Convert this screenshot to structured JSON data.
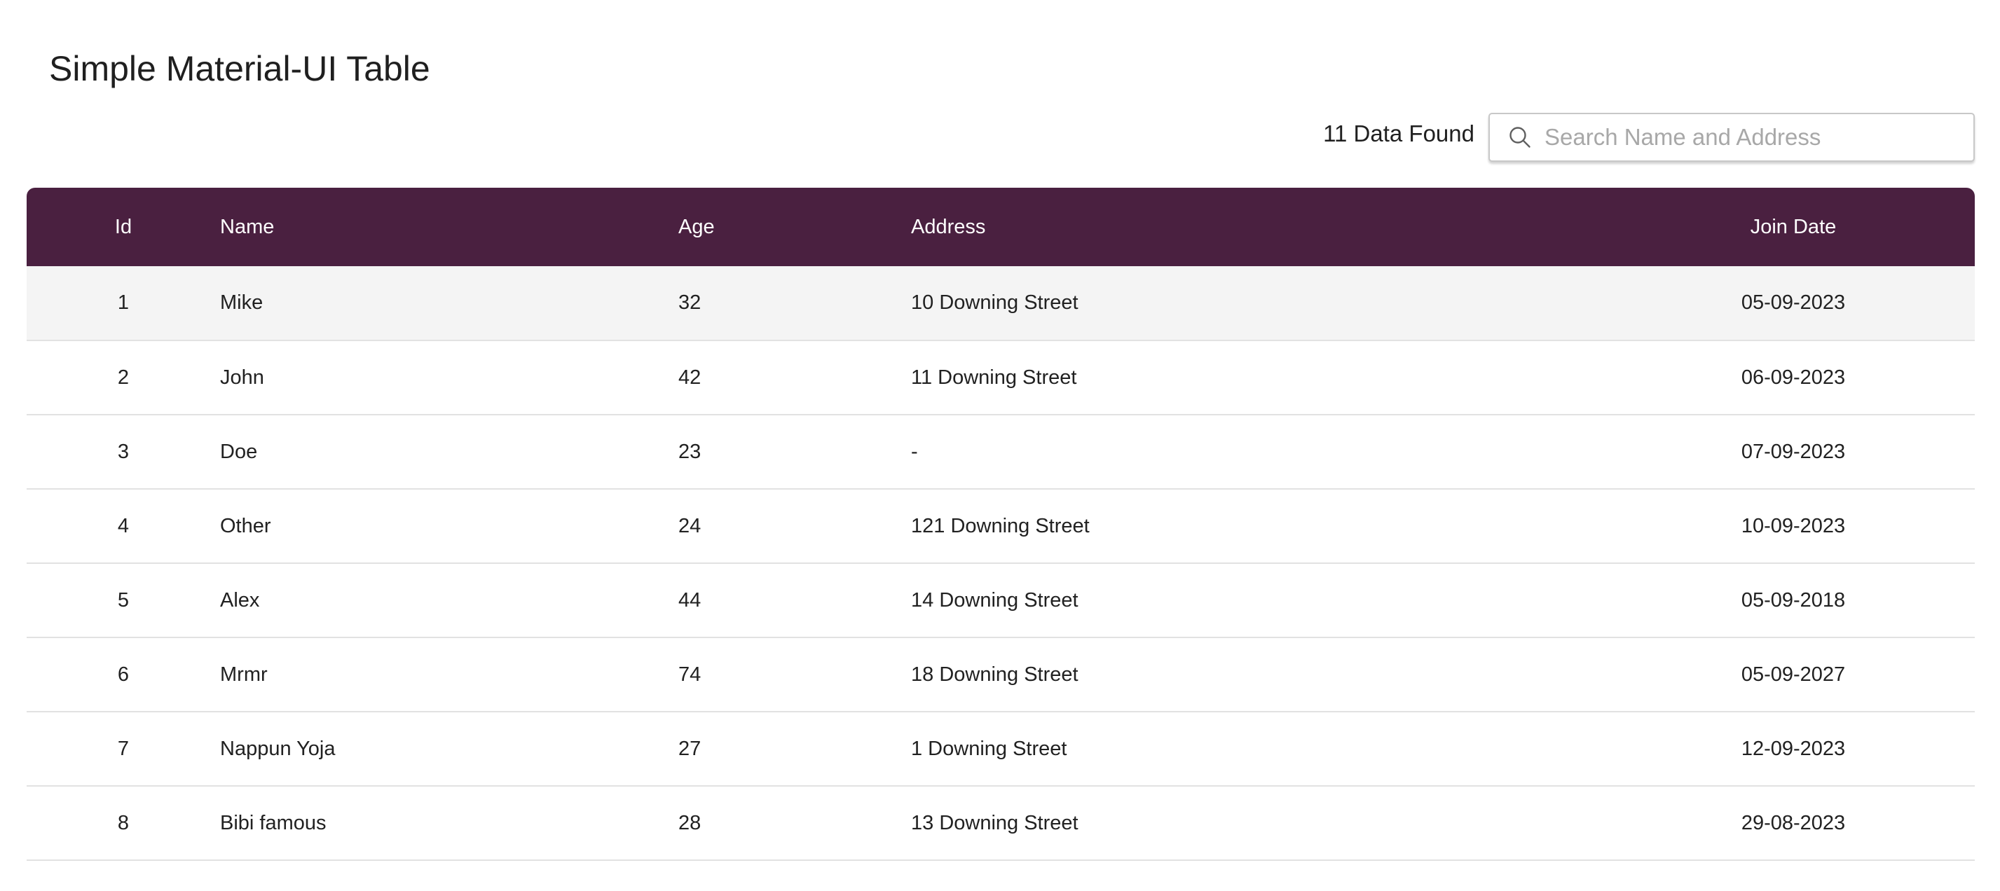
{
  "page": {
    "title": "Simple Material-UI Table"
  },
  "toolbar": {
    "count_label": "11 Data Found",
    "search_placeholder": "Search Name and Address",
    "search_value": ""
  },
  "colors": {
    "header_bg": "#4a2040",
    "header_text": "#ffffff",
    "highlight_row": "#f4f4f4"
  },
  "table": {
    "columns": [
      "Id",
      "Name",
      "Age",
      "Address",
      "Join Date"
    ],
    "rows": [
      {
        "id": "1",
        "name": "Mike",
        "age": "32",
        "address": "10 Downing Street",
        "join_date": "05-09-2023"
      },
      {
        "id": "2",
        "name": "John",
        "age": "42",
        "address": "11 Downing Street",
        "join_date": "06-09-2023"
      },
      {
        "id": "3",
        "name": "Doe",
        "age": "23",
        "address": "-",
        "join_date": "07-09-2023"
      },
      {
        "id": "4",
        "name": "Other",
        "age": "24",
        "address": "121 Downing Street",
        "join_date": "10-09-2023"
      },
      {
        "id": "5",
        "name": "Alex",
        "age": "44",
        "address": "14 Downing Street",
        "join_date": "05-09-2018"
      },
      {
        "id": "6",
        "name": "Mrmr",
        "age": "74",
        "address": "18 Downing Street",
        "join_date": "05-09-2027"
      },
      {
        "id": "7",
        "name": "Nappun Yoja",
        "age": "27",
        "address": "1 Downing Street",
        "join_date": "12-09-2023"
      },
      {
        "id": "8",
        "name": "Bibi famous",
        "age": "28",
        "address": "13 Downing Street",
        "join_date": "29-08-2023"
      }
    ]
  }
}
